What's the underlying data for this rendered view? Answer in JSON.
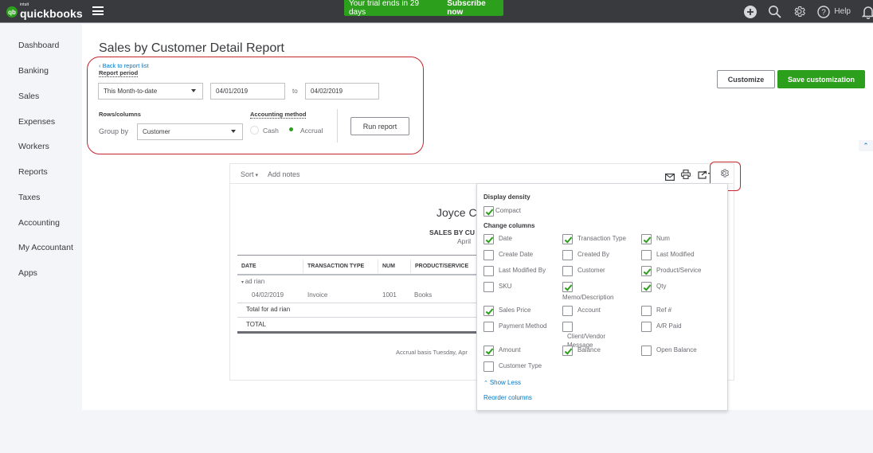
{
  "topbar": {
    "logo_small": "intuit",
    "logo_text": "quickbooks",
    "logo_badge": "qb",
    "trial_text": "Your trial ends in 29 days",
    "subscribe_label": "Subscribe now",
    "help_label": "Help",
    "icons": [
      "plus-circle-icon",
      "search-icon",
      "gear-icon",
      "help-icon",
      "bell-icon"
    ]
  },
  "sidebar": {
    "items": [
      {
        "label": "Dashboard"
      },
      {
        "label": "Banking"
      },
      {
        "label": "Sales"
      },
      {
        "label": "Expenses"
      },
      {
        "label": "Workers"
      },
      {
        "label": "Reports"
      },
      {
        "label": "Taxes"
      },
      {
        "label": "Accounting"
      },
      {
        "label": "My Accountant"
      },
      {
        "label": "Apps"
      }
    ]
  },
  "header": {
    "title": "Sales by Customer Detail Report",
    "back_link": "Back to report list",
    "customize_label": "Customize",
    "save_customization_label": "Save customization"
  },
  "filters": {
    "report_period_label": "Report period",
    "period_value": "This Month-to-date",
    "from_date": "04/01/2019",
    "to_label": "to",
    "to_date": "04/02/2019",
    "rows_columns_label": "Rows/columns",
    "group_by_label": "Group by",
    "group_by_value": "Customer",
    "accounting_method_label": "Accounting method",
    "methods": [
      {
        "label": "Cash",
        "selected": false
      },
      {
        "label": "Accrual",
        "selected": true
      }
    ],
    "run_report_label": "Run report"
  },
  "report": {
    "toolbar": {
      "sort_label": "Sort",
      "add_notes_label": "Add notes",
      "icons": [
        "email-icon",
        "print-icon",
        "export-icon",
        "settings-gear-icon"
      ]
    },
    "company_name": "Joyce C",
    "title": "SALES BY CU",
    "date_range": "April",
    "columns": [
      "DATE",
      "TRANSACTION TYPE",
      "NUM",
      "PRODUCT/SERVICE"
    ],
    "group_name": "ad rian",
    "rows": [
      {
        "date": "04/02/2019",
        "type": "Invoice",
        "num": "1001",
        "product": "Books"
      }
    ],
    "group_total_label": "Total for ad rian",
    "total_label": "TOTAL",
    "footer": "Accrual basis  Tuesday, Apr"
  },
  "settings_popover": {
    "display_density_label": "Display density",
    "compact": {
      "label": "Compact",
      "checked": true
    },
    "change_columns_label": "Change columns",
    "columns": [
      {
        "label": "Date",
        "checked": true
      },
      {
        "label": "Transaction Type",
        "checked": true
      },
      {
        "label": "Num",
        "checked": true
      },
      {
        "label": "Create Date",
        "checked": false
      },
      {
        "label": "Created By",
        "checked": false
      },
      {
        "label": "Last Modified",
        "checked": false
      },
      {
        "label": "Last Modified By",
        "checked": false
      },
      {
        "label": "Customer",
        "checked": false
      },
      {
        "label": "Product/Service",
        "checked": true
      },
      {
        "label": "SKU",
        "checked": false
      },
      {
        "label": "Memo/Description",
        "checked": true
      },
      {
        "label": "Qty",
        "checked": true
      },
      {
        "label": "Sales Price",
        "checked": true
      },
      {
        "label": "Account",
        "checked": false
      },
      {
        "label": "Ref #",
        "checked": false
      },
      {
        "label": "Payment Method",
        "checked": false
      },
      {
        "label": "Client/Vendor Message",
        "checked": false
      },
      {
        "label": "A/R Paid",
        "checked": false
      },
      {
        "label": "Amount",
        "checked": true
      },
      {
        "label": "Balance",
        "checked": true
      },
      {
        "label": "Open Balance",
        "checked": false
      },
      {
        "label": "Customer Type",
        "checked": false
      }
    ],
    "show_less_label": "Show Less",
    "reorder_columns_label": "Reorder columns"
  },
  "colors": {
    "brand_green": "#2ca01c",
    "topbar": "#393a3d",
    "link_blue": "#0077c5",
    "highlight_red": "#c4262e"
  }
}
